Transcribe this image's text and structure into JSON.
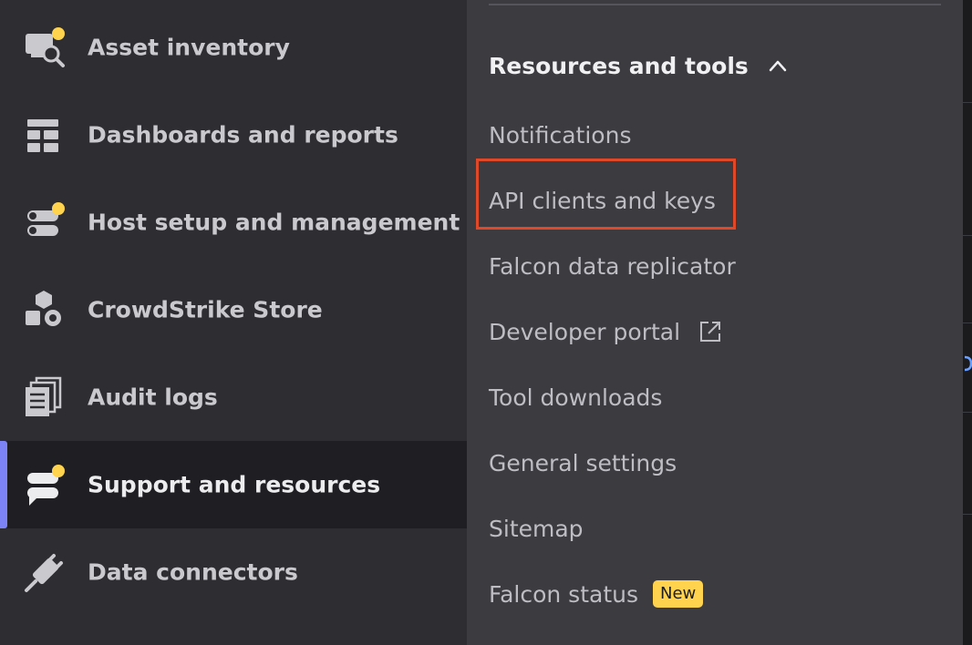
{
  "sidebar": {
    "items": [
      {
        "label": "Asset inventory",
        "icon": "asset-inventory-icon",
        "notification_dot": true
      },
      {
        "label": "Dashboards and reports",
        "icon": "dashboard-icon",
        "notification_dot": false
      },
      {
        "label": "Host setup and management",
        "icon": "toggle-settings-icon",
        "notification_dot": true
      },
      {
        "label": "CrowdStrike Store",
        "icon": "store-shapes-icon",
        "notification_dot": false
      },
      {
        "label": "Audit logs",
        "icon": "documents-icon",
        "notification_dot": false
      },
      {
        "label": "Support and resources",
        "icon": "support-chat-icon",
        "notification_dot": true,
        "active": true
      },
      {
        "label": "Data connectors",
        "icon": "plug-icon",
        "notification_dot": false
      }
    ]
  },
  "panel": {
    "section_title": "Resources and tools",
    "section_expanded": true,
    "items": [
      {
        "label": "Notifications"
      },
      {
        "label": "API clients and keys",
        "highlighted": true
      },
      {
        "label": "Falcon data replicator"
      },
      {
        "label": "Developer portal",
        "external": true
      },
      {
        "label": "Tool downloads"
      },
      {
        "label": "General settings"
      },
      {
        "label": "Sitemap"
      },
      {
        "label": "Falcon status",
        "badge": "New"
      }
    ]
  },
  "colors": {
    "highlight_border": "#e0482a",
    "active_indicator": "#7b83f5",
    "notification_dot": "#ffd34d",
    "badge_bg": "#ffd34d"
  }
}
